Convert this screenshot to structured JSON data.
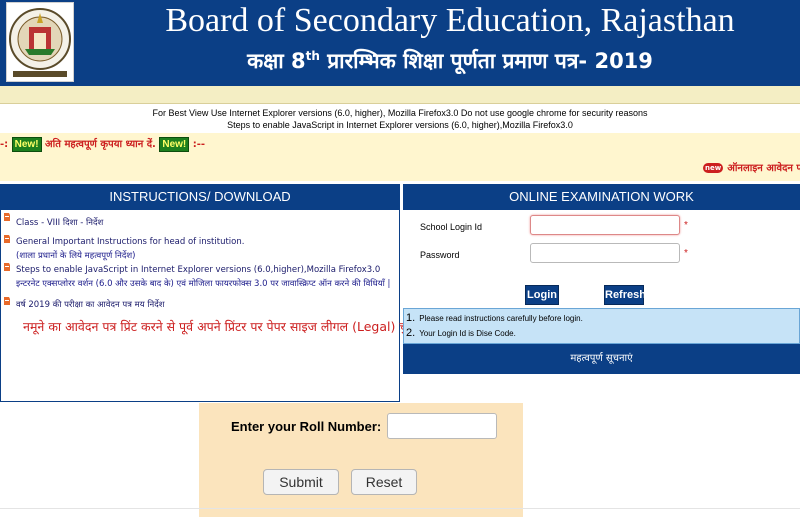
{
  "header": {
    "title_en": "Board of Secondary Education, Rajasthan",
    "title_hi_prefix": "कक्षा 8",
    "title_hi_sup": "th",
    "title_hi_suffix": " प्रारम्भिक शिक्षा पूर्णता प्रमाण पत्र- 2019"
  },
  "notices": {
    "browser": "For Best View Use Internet Explorer versions (6.0, higher), Mozilla Firefox3.0 Do not use google chrome for security reasons",
    "javascript": "Steps to enable JavaScript in Internet Explorer versions (6.0, higher),Mozilla Firefox3.0"
  },
  "attention": {
    "prefix": "-: ",
    "new_badge": "New!",
    "text": "अति महत्वपूर्ण कृपया ध्यान दें.",
    "suffix": " :--"
  },
  "marquee": {
    "icon": "new",
    "text": "ऑनलाइन आवेदन फॉ"
  },
  "instructions": {
    "heading": "INSTRUCTIONS/ DOWNLOAD",
    "items": [
      {
        "text": "Class - VIII दिशा - निर्देश"
      },
      {
        "text": "General Important Instructions for head of institution.",
        "sub": "(शाला प्रधानों के लिये महत्वपूर्ण निर्देश)"
      },
      {
        "text": "Steps to enable JavaScript in Internet Explorer versions (6.0,higher),Mozilla Firefox3.0",
        "sub": "इन्टरनेट एक्सप्लोरर वर्शन (6.0 और उसके बाद के) एवं मोजिला फायरफोक्स 3.0 पर जावास्क्रिप्ट ऑन करने की विधियाँ |"
      },
      {
        "text": "वर्ष 2019 की परीक्षा का आवेदन पत्र मय निर्देश"
      }
    ],
    "legal_note": "नमूने का आवेदन पत्र प्रिंट करने से पूर्व अपने प्रिंटर पर पेपर साइज लीगल (Legal) चुनें|"
  },
  "login": {
    "heading": "ONLINE EXAMINATION WORK",
    "school_label": "School Login Id",
    "password_label": "Password",
    "required_mark": "*",
    "login_button": "Login",
    "refresh_button": "Refresh",
    "info": [
      {
        "num": "1.",
        "text": "Please read instructions carefully before login."
      },
      {
        "num": "2.",
        "text": "Your Login Id is Dise Code."
      }
    ],
    "important_notice": "महत्वपूर्ण सूचनाएं"
  },
  "roll": {
    "label": "Enter your Roll Number:",
    "submit": "Submit",
    "reset": "Reset"
  },
  "colors": {
    "primary": "#0b3f86",
    "attention_red": "#cc1f1f",
    "roll_bg": "#fbe4bd",
    "info_bg": "#c6e3f7"
  }
}
